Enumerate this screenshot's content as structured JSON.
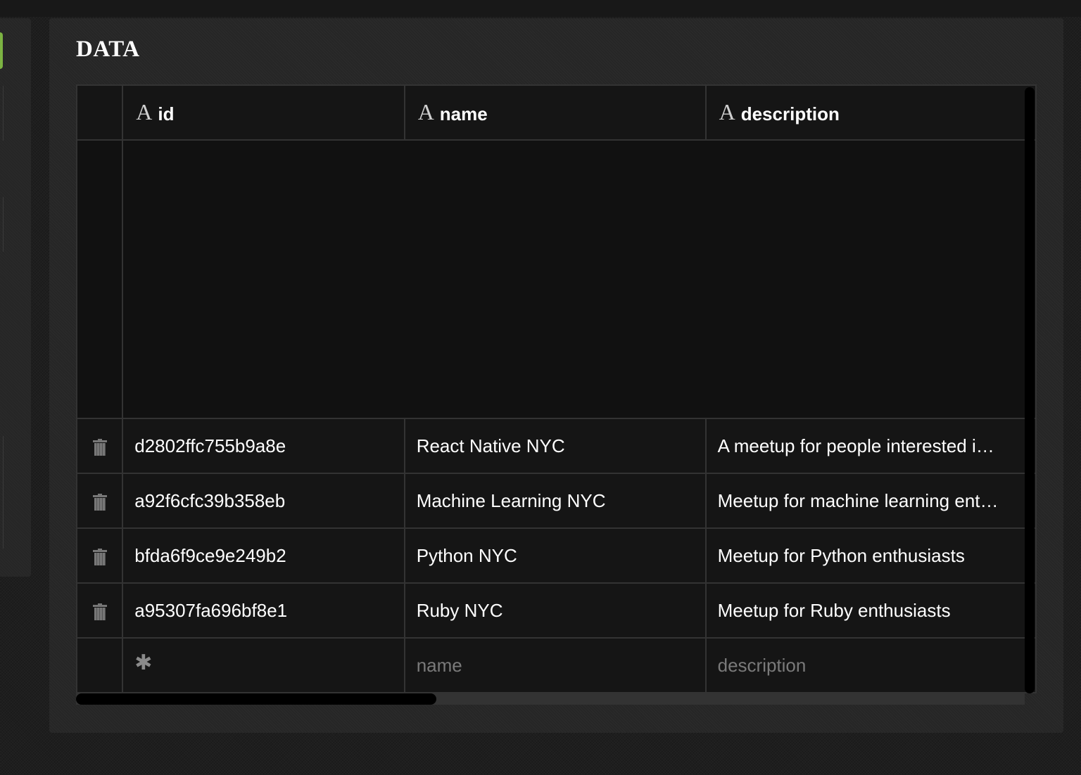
{
  "panel": {
    "title": "DATA"
  },
  "table": {
    "columns": [
      {
        "type_icon": "A",
        "label": "id"
      },
      {
        "type_icon": "A",
        "label": "name"
      },
      {
        "type_icon": "A",
        "label": "description"
      }
    ],
    "rows": [
      {
        "id": "d2802ffc755b9a8e",
        "name": "React Native NYC",
        "description": "A meetup for people interested i…"
      },
      {
        "id": "a92f6cfc39b358eb",
        "name": "Machine Learning NYC",
        "description": "Meetup for machine learning ent…"
      },
      {
        "id": "bfda6f9ce9e249b2",
        "name": "Python NYC",
        "description": "Meetup for Python enthusiasts"
      },
      {
        "id": "a95307fa696bf8e1",
        "name": "Ruby NYC",
        "description": "Meetup for Ruby enthusiasts"
      }
    ],
    "new_row": {
      "id_marker": "✱",
      "name_placeholder": "name",
      "description_placeholder": "description"
    }
  },
  "colors": {
    "accent": "#7cb342",
    "background": "#1e1e1e",
    "panel": "#262626",
    "grid": "#151515",
    "border": "#333333"
  },
  "icons": {
    "row_delete": "trash-icon",
    "column_type": "text-type-icon",
    "new_row_marker": "asterisk-icon"
  }
}
